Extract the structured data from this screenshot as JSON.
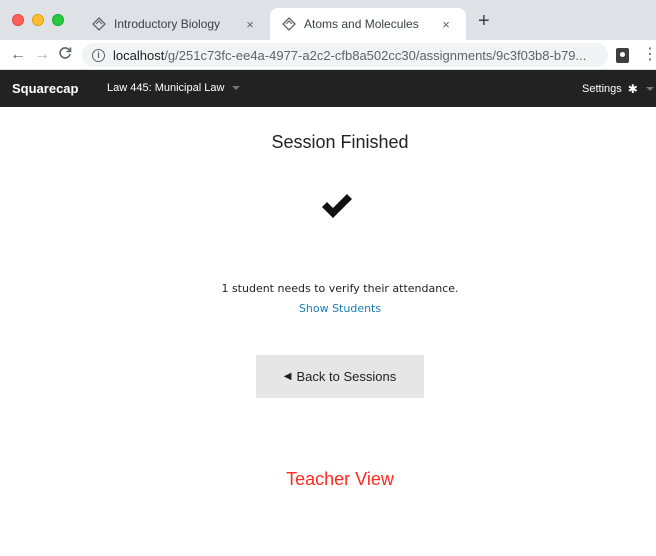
{
  "browser": {
    "tabs": [
      {
        "title": "Introductory Biology",
        "close": "×",
        "active": false
      },
      {
        "title": "Atoms and Molecules",
        "close": "×",
        "active": true
      }
    ],
    "new_tab": "+",
    "nav": {
      "back": "←",
      "forward": "→",
      "reload": "C"
    },
    "url": {
      "host": "localhost",
      "path": "/g/251c73fc-ee4a-4977-a2c2-cfb8a502cc30/assignments/9c3f03b8-b79..."
    },
    "menu": "⋮"
  },
  "navbar": {
    "brand": "Squarecap",
    "course": "Law 445: Municipal Law",
    "settings": "Settings"
  },
  "main": {
    "title": "Session Finished",
    "attendance_message": "1 student needs to verify their attendance.",
    "show_students": "Show Students",
    "back_button": "Back to Sessions",
    "view_label": "Teacher View"
  },
  "colors": {
    "navbar_bg": "#222222",
    "link": "#1a7fb5",
    "teacher_view": "#ff2a1f",
    "button_bg": "#e6e6e6"
  },
  "icons": [
    "info-icon",
    "check-icon",
    "gear-icon",
    "back-arrow-icon",
    "diamond-favicon-icon"
  ]
}
